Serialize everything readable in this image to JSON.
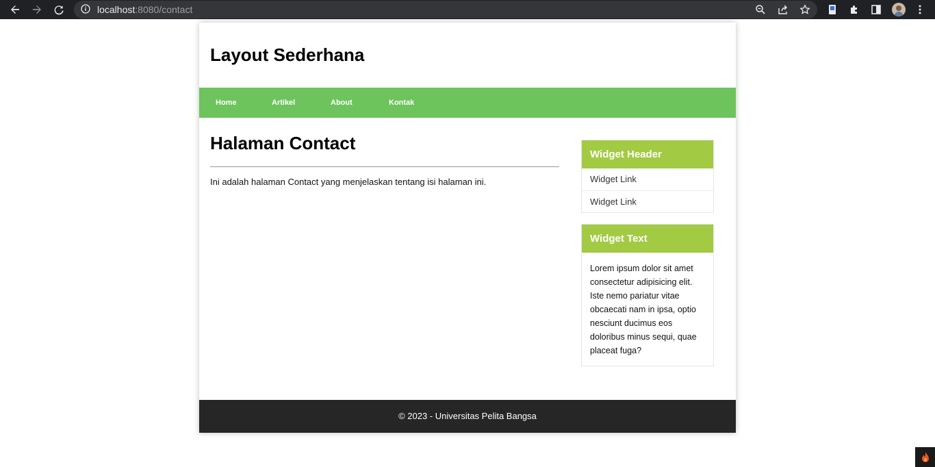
{
  "browser": {
    "url_host": "localhost",
    "url_rest": ":8080/contact",
    "icons": [
      "back-arrow-icon",
      "forward-arrow-icon",
      "reload-icon",
      "info-icon",
      "zoom-icon",
      "share-icon",
      "star-icon",
      "extension-icon",
      "puzzle-icon",
      "sidepanel-icon",
      "avatar",
      "menu-dots-icon"
    ]
  },
  "site": {
    "title": "Layout Sederhana",
    "nav": [
      "Home",
      "Artikel",
      "About",
      "Kontak"
    ]
  },
  "main": {
    "title": "Halaman Contact",
    "text": "Ini adalah halaman Contact yang menjelaskan tentang isi halaman ini."
  },
  "sidebar": {
    "widget1": {
      "header": "Widget Header",
      "links": [
        "Widget Link",
        "Widget Link"
      ]
    },
    "widget2": {
      "header": "Widget Text",
      "body": "Lorem ipsum dolor sit amet consectetur adipisicing elit. Iste nemo pariatur vitae obcaecati nam in ipsa, optio nesciunt ducimus eos doloribus minus sequi, quae placeat fuga?"
    }
  },
  "footer": {
    "text": "© 2023 - Universitas Pelita Bangsa"
  },
  "colors": {
    "nav_green": "#6dc35c",
    "widget_green": "#a2ca43",
    "footer_dark": "#262626",
    "chrome_dark": "#202124"
  }
}
